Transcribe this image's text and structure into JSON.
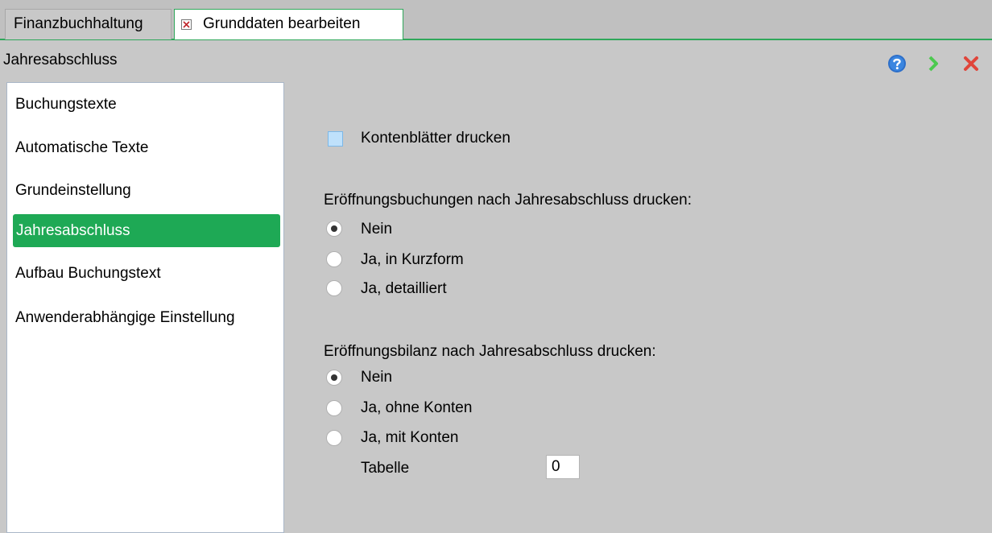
{
  "tabs": [
    {
      "label": "Finanzbuchhaltung",
      "active": false
    },
    {
      "label": "Grunddaten bearbeiten",
      "active": true
    }
  ],
  "section_title": "Jahresabschluss",
  "header_icons": [
    "help-icon",
    "forward-arrow-icon",
    "close-icon"
  ],
  "colors": {
    "accent_green": "#1ea955",
    "tab_border": "#2fa75a",
    "checkbox_fill": "#bfe1fb"
  },
  "nav": {
    "items": [
      {
        "label": "Buchungstexte"
      },
      {
        "label": "Automatische Texte"
      },
      {
        "label": "Grundeinstellung"
      },
      {
        "label": "Jahresabschluss",
        "selected": true
      },
      {
        "label": "Aufbau Buchungstext"
      },
      {
        "label": "Anwenderabhängige Einstellung"
      }
    ]
  },
  "form": {
    "print_account_sheets": {
      "label": "Kontenblätter drucken",
      "checked": false
    },
    "opening_entries": {
      "question": "Eröffnungsbuchungen nach Jahresabschluss drucken:",
      "options": [
        "Nein",
        "Ja, in Kurzform",
        "Ja, detailliert"
      ],
      "selected": "Nein"
    },
    "opening_balance": {
      "question": "Eröffnungsbilanz nach Jahresabschluss drucken:",
      "options": [
        "Nein",
        "Ja, ohne Konten",
        "Ja, mit Konten"
      ],
      "selected": "Nein"
    },
    "table": {
      "label": "Tabelle",
      "value": "0"
    }
  }
}
